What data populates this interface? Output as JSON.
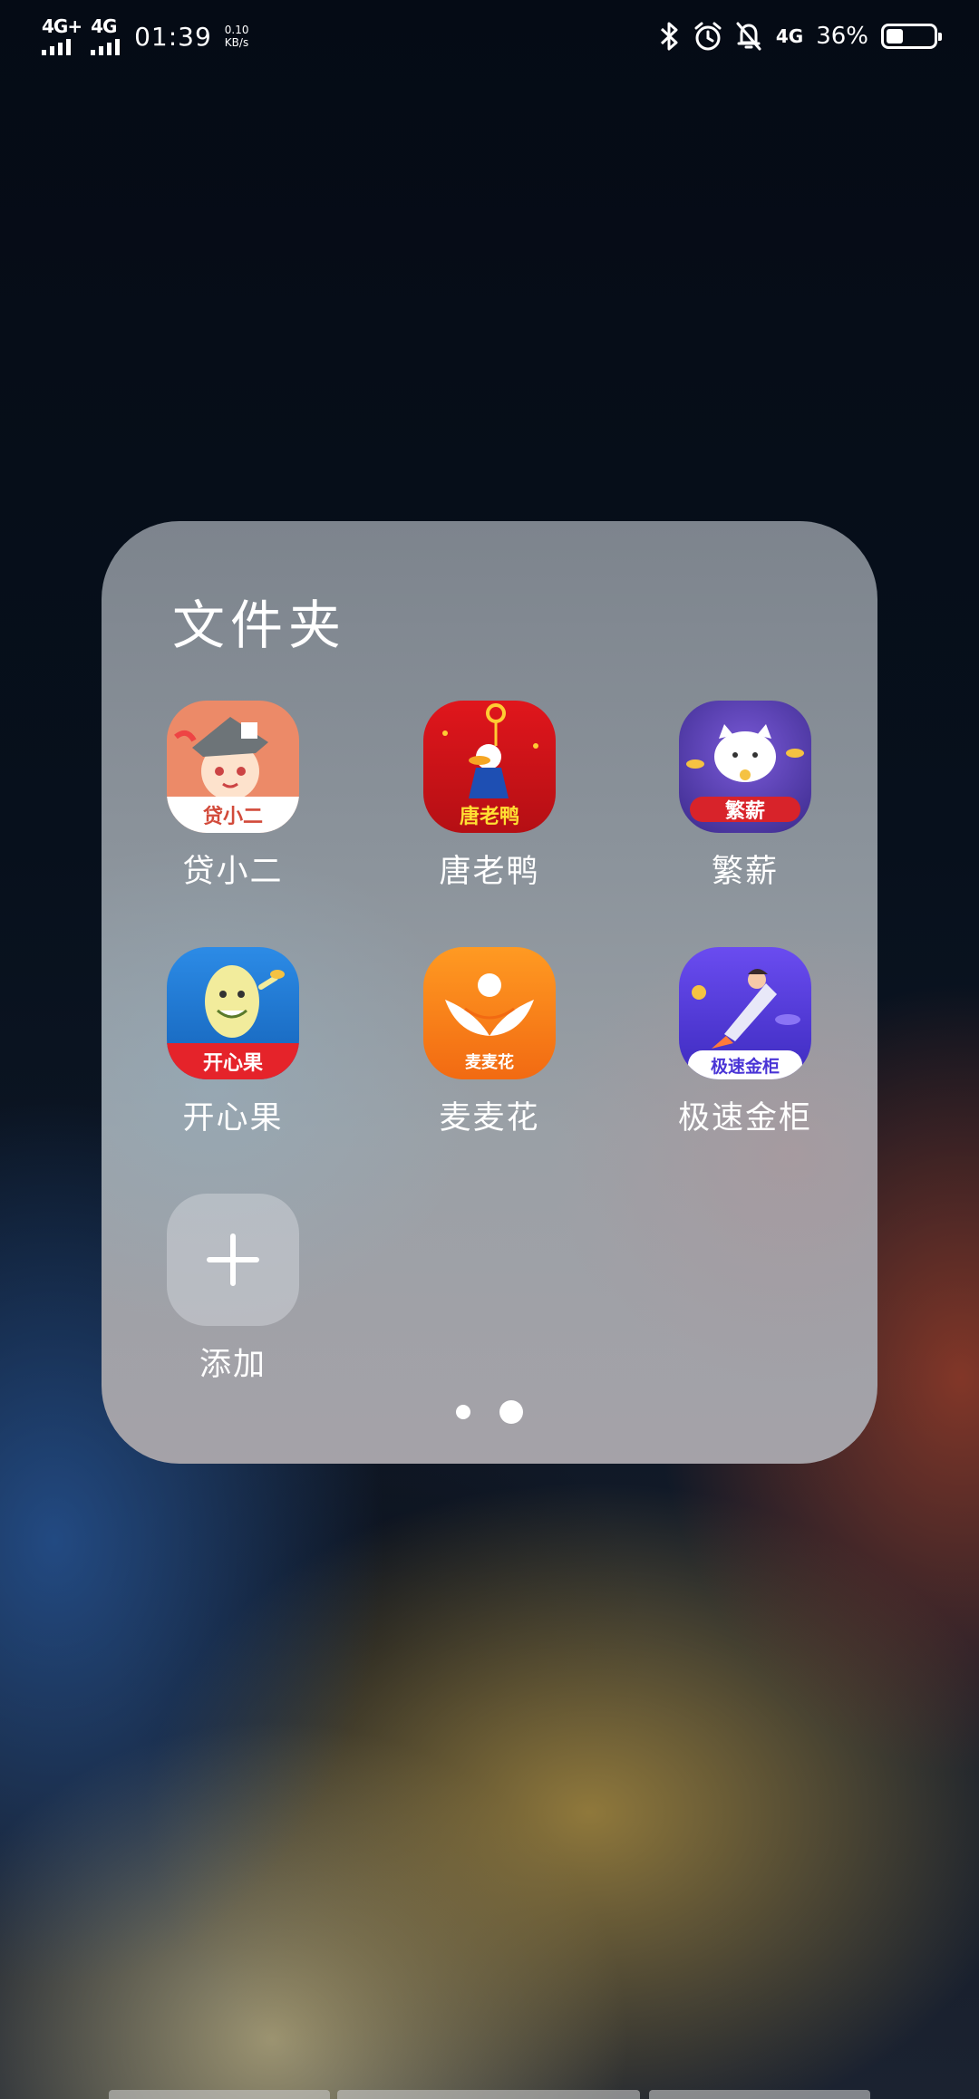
{
  "status_bar": {
    "sim1": "4G+",
    "sim2": "4G",
    "time": "01:39",
    "speed_value": "0.10",
    "speed_unit": "KB/s",
    "data_network": "4G",
    "battery_percent": "36%",
    "battery_level": 0.36,
    "icons": [
      "bluetooth-icon",
      "alarm-icon",
      "silent-bell-icon"
    ]
  },
  "folder": {
    "title": "文件夹",
    "apps": [
      {
        "label": "贷小二",
        "banner": "贷小二",
        "color": "#ec8a68"
      },
      {
        "label": "唐老鸭",
        "banner": "唐老鸭",
        "color": "#d8161c"
      },
      {
        "label": "繁薪",
        "banner": "繁薪",
        "color": "#4a3bb0"
      },
      {
        "label": "开心果",
        "banner": "开心果",
        "color": "#1d7fd8"
      },
      {
        "label": "麦麦花",
        "banner": "麦麦花",
        "color": "#f57d18"
      },
      {
        "label": "极速金柜",
        "banner": "极速金柜",
        "color": "#5a3fe0"
      }
    ],
    "add_label": "添加",
    "pages": 2,
    "current_page": 2
  }
}
